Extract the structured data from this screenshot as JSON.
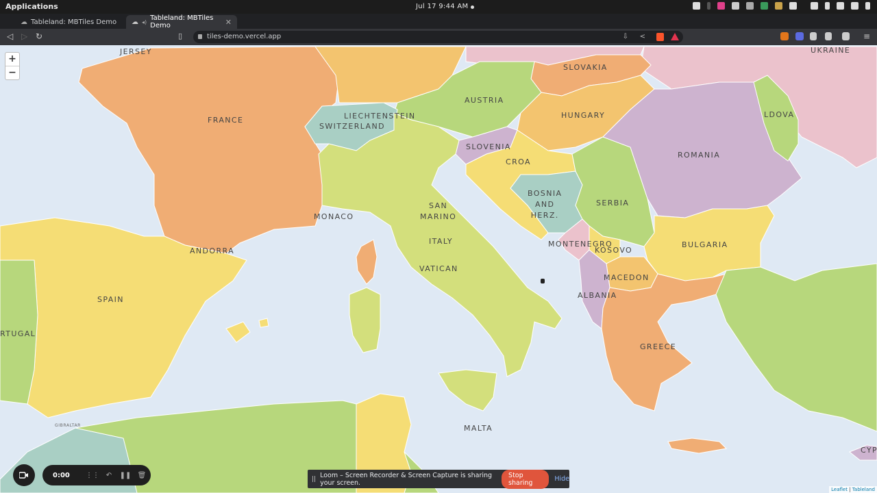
{
  "os_bar": {
    "apps_label": "Applications",
    "clock": "Jul 17  9:44 AM"
  },
  "tabs": [
    {
      "title": "Tableland: MBTiles Demo",
      "active": false
    },
    {
      "title": "Tableland: MBTiles Demo",
      "active": true
    }
  ],
  "address": {
    "url": "tiles-demo.vercel.app"
  },
  "map": {
    "zoom_in": "+",
    "zoom_out": "−",
    "labels": {
      "jersey": "JERSEY",
      "france": "FRANCE",
      "ukraine": "UKRAINE",
      "slovakia": "SLOVAKIA",
      "austria": "AUSTRIA",
      "hungary": "HUNGARY",
      "liechtenstein": "LIECHTENSTEIN",
      "switzerland": "SWITZERLAND",
      "moldova": "LDOVA",
      "romania": "ROMANIA",
      "slovenia": "SLOVENIA",
      "croatia": "CROA",
      "bosnia": "BOSNIA\nAND\nHERZ.",
      "serbia": "SERBIA",
      "monaco": "MONACO",
      "san_marino": "SAN\nMARINO",
      "italy": "ITALY",
      "andorra": "ANDORRA",
      "montenegro": "MONTENEGRO",
      "kosovo": "KOSOVO",
      "bulgaria": "BULGARIA",
      "vatican": "VATICAN",
      "macedonia": "MACEDON",
      "albania": "ALBANIA",
      "spain": "SPAIN",
      "portugal": "RTUGAL",
      "greece": "GREECE",
      "malta": "MALTA",
      "gibraltar": "GIBRALTAR",
      "cyprus": "CYP"
    },
    "attribution": {
      "leaflet": "Leaflet",
      "sep": " | ",
      "tableland": "Tableland"
    }
  },
  "loom": {
    "timer": "0:00"
  },
  "share_bar": {
    "pause_icon": "||",
    "message": "Loom – Screen Recorder & Screen Capture is sharing your screen.",
    "stop_label": "Stop sharing",
    "hide_label": "Hide"
  },
  "colors": {
    "sea": "#dfe9f4",
    "orange": "#f0ad74",
    "yellow": "#f5dd75",
    "green": "#b7d77c",
    "lightgreen": "#d3df7c",
    "purple": "#cdb3cf",
    "pink": "#ebc2cc",
    "teal": "#a9cfc4",
    "peach": "#f3c46f"
  }
}
